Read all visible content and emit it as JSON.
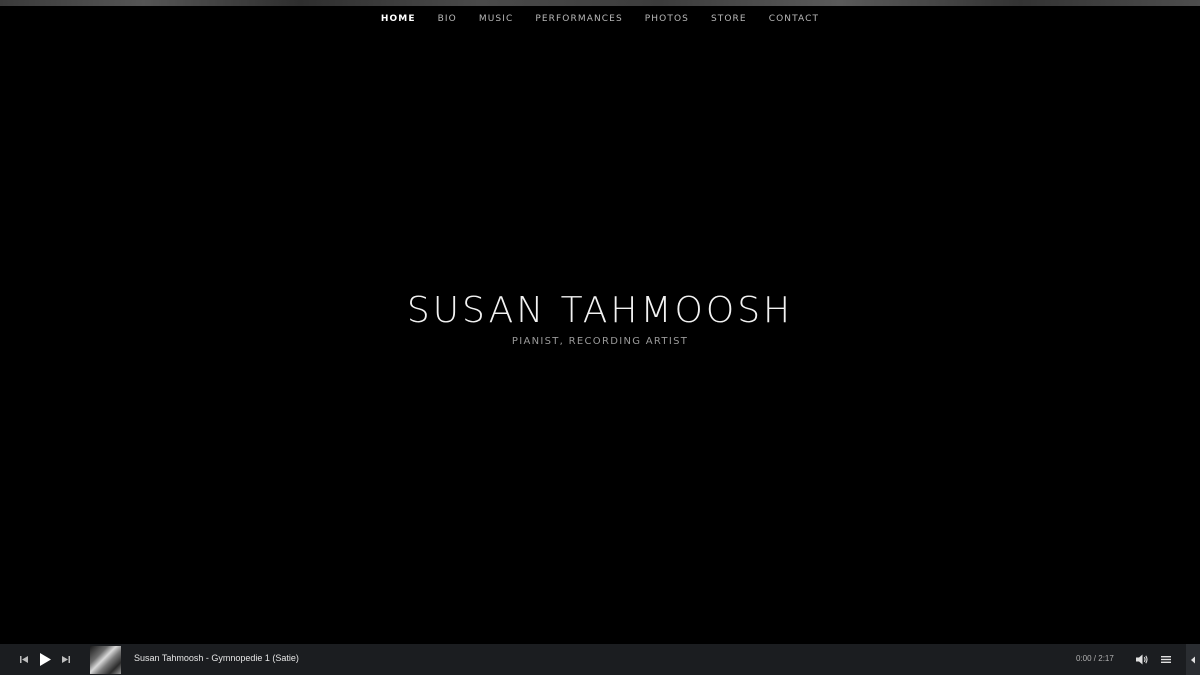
{
  "nav": {
    "items": [
      {
        "label": "HOME",
        "active": true
      },
      {
        "label": "BIO"
      },
      {
        "label": "MUSIC"
      },
      {
        "label": "PERFORMANCES"
      },
      {
        "label": "PHOTOS"
      },
      {
        "label": "STORE"
      },
      {
        "label": "CONTACT"
      }
    ]
  },
  "hero": {
    "title": "SUSAN TAHMOOSH",
    "subtitle": "PIANIST, RECORDING ARTIST"
  },
  "player": {
    "track_title": "Susan Tahmoosh - Gymnopedie 1 (Satie)",
    "time": "0:00 / 2:17",
    "state": "paused",
    "icons": [
      "prev-icon",
      "play-icon",
      "next-icon",
      "volume-icon",
      "playlist-icon",
      "collapse-icon"
    ]
  },
  "colors": {
    "background": "#000000",
    "player_bar": "#1b1d20",
    "nav_text": "#b8b8b8",
    "title_text": "#f2f2f2",
    "subtitle_text": "#9a9a9a"
  }
}
